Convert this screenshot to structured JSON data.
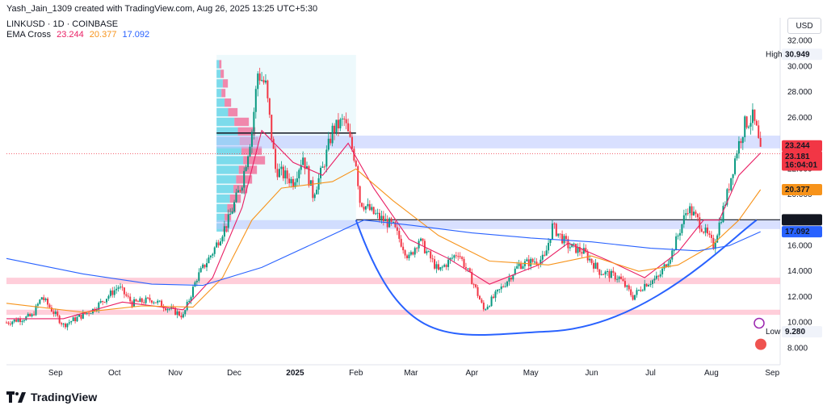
{
  "header": {
    "created_by": "Yash_Jain_1309 created with TradingView.com, Aug 26, 2025 13:25 UTC+5:30",
    "symbol_line": "LINKUSD · 1D · COINBASE",
    "indicator": "EMA Cross",
    "ema_values": [
      "23.244",
      "20.377",
      "17.092"
    ]
  },
  "currency": "USD",
  "brand": "TradingView",
  "colors": {
    "up": "#089981",
    "down": "#f23645",
    "ema_fast": "#e91e63",
    "ema_mid": "#f7931a",
    "ema_slow": "#2962ff",
    "zone_blue": "#b9c7ff",
    "zone_pink": "#ffb3c6",
    "arc": "#2962ff"
  },
  "chart_data": {
    "type": "candlestick",
    "title": "LINKUSD · 1D · COINBASE",
    "x_ticks": [
      "Sep",
      "Oct",
      "Nov",
      "Dec",
      "2025",
      "Feb",
      "Mar",
      "Apr",
      "May",
      "Jun",
      "Jul",
      "Aug",
      "Sep"
    ],
    "y_ticks": [
      "32.000",
      "30.000",
      "28.000",
      "26.000",
      "22.000",
      "20.000",
      "16.000",
      "14.000",
      "12.000",
      "10.000",
      "8.000"
    ],
    "ylim": [
      6.7,
      33.3
    ],
    "x_start": "2024-08-07",
    "x_end": "2025-09-05",
    "price_labels": [
      {
        "label": "High",
        "value": "30.949"
      },
      {
        "label": "",
        "value": "23.244"
      },
      {
        "label": "",
        "value": "23.181"
      },
      {
        "label": "",
        "value": "16:04:01"
      },
      {
        "label": "",
        "value": "20.377"
      },
      {
        "label": "",
        "value": "18.025"
      },
      {
        "label": "",
        "value": "17.092"
      },
      {
        "label": "Low",
        "value": "9.280"
      }
    ],
    "key_levels": {
      "resistance": 18.025,
      "last": 23.181,
      "high": 30.949,
      "low": 9.28
    },
    "zones": [
      {
        "kind": "blue",
        "from": 23.6,
        "to": 24.6,
        "start": "2024-11-22",
        "end": "2025-09-05"
      },
      {
        "kind": "blue",
        "from": 17.3,
        "to": 18.0,
        "start": "2024-11-22",
        "end": "2025-09-05"
      },
      {
        "kind": "pink",
        "from": 13.0,
        "to": 13.5,
        "start": "2024-08-07",
        "end": "2025-09-05"
      },
      {
        "kind": "pink",
        "from": 10.6,
        "to": 11.0,
        "start": "2024-08-07",
        "end": "2025-09-05"
      }
    ],
    "arc": {
      "start": "2025-02-01",
      "start_value": 18.0,
      "bottom": "2025-05-10",
      "bottom_value": 9.3,
      "end": "2025-08-24",
      "end_value": 18.0
    },
    "series": [
      {
        "name": "LINKUSD",
        "close": [
          [
            "2024-08-07",
            10.0
          ],
          [
            "2024-08-20",
            10.5
          ],
          [
            "2024-08-25",
            12.0
          ],
          [
            "2024-09-05",
            9.8
          ],
          [
            "2024-09-20",
            11.0
          ],
          [
            "2024-10-03",
            12.8
          ],
          [
            "2024-10-10",
            11.5
          ],
          [
            "2024-10-20",
            11.8
          ],
          [
            "2024-11-05",
            10.5
          ],
          [
            "2024-11-12",
            13.5
          ],
          [
            "2024-11-20",
            15.5
          ],
          [
            "2024-11-28",
            18.0
          ],
          [
            "2024-12-05",
            21.0
          ],
          [
            "2024-12-10",
            25.0
          ],
          [
            "2024-12-13",
            29.5
          ],
          [
            "2024-12-17",
            28.5
          ],
          [
            "2024-12-22",
            22.0
          ],
          [
            "2024-12-31",
            21.0
          ],
          [
            "2025-01-05",
            23.0
          ],
          [
            "2025-01-10",
            20.0
          ],
          [
            "2025-01-15",
            22.0
          ],
          [
            "2025-01-20",
            25.0
          ],
          [
            "2025-01-26",
            25.8
          ],
          [
            "2025-02-01",
            22.5
          ],
          [
            "2025-02-03",
            19.5
          ],
          [
            "2025-02-10",
            18.5
          ],
          [
            "2025-02-20",
            17.5
          ],
          [
            "2025-02-28",
            15.0
          ],
          [
            "2025-03-05",
            16.5
          ],
          [
            "2025-03-15",
            14.0
          ],
          [
            "2025-03-25",
            15.5
          ],
          [
            "2025-04-02",
            13.0
          ],
          [
            "2025-04-07",
            11.0
          ],
          [
            "2025-04-15",
            12.5
          ],
          [
            "2025-04-25",
            14.5
          ],
          [
            "2025-05-08",
            15.0
          ],
          [
            "2025-05-12",
            17.5
          ],
          [
            "2025-05-20",
            16.0
          ],
          [
            "2025-05-28",
            15.5
          ],
          [
            "2025-06-05",
            14.0
          ],
          [
            "2025-06-15",
            13.5
          ],
          [
            "2025-06-22",
            12.0
          ],
          [
            "2025-06-28",
            13.0
          ],
          [
            "2025-07-05",
            13.5
          ],
          [
            "2025-07-12",
            15.5
          ],
          [
            "2025-07-20",
            19.0
          ],
          [
            "2025-07-25",
            18.0
          ],
          [
            "2025-08-02",
            16.0
          ],
          [
            "2025-08-09",
            20.0
          ],
          [
            "2025-08-14",
            23.5
          ],
          [
            "2025-08-18",
            25.5
          ],
          [
            "2025-08-22",
            26.0
          ],
          [
            "2025-08-24",
            25.0
          ],
          [
            "2025-08-26",
            23.181
          ]
        ]
      },
      {
        "name": "EMA fast",
        "values": [
          [
            "2024-08-07",
            10.3
          ],
          [
            "2024-09-05",
            10.3
          ],
          [
            "2024-10-05",
            11.6
          ],
          [
            "2024-11-05",
            11.0
          ],
          [
            "2024-11-20",
            13.5
          ],
          [
            "2024-12-05",
            19.0
          ],
          [
            "2024-12-15",
            25.0
          ],
          [
            "2024-12-31",
            22.5
          ],
          [
            "2025-01-15",
            21.5
          ],
          [
            "2025-01-28",
            24.0
          ],
          [
            "2025-02-10",
            20.5
          ],
          [
            "2025-02-28",
            16.5
          ],
          [
            "2025-03-20",
            15.0
          ],
          [
            "2025-04-10",
            13.0
          ],
          [
            "2025-05-05",
            14.5
          ],
          [
            "2025-05-20",
            16.2
          ],
          [
            "2025-06-10",
            14.8
          ],
          [
            "2025-06-28",
            13.5
          ],
          [
            "2025-07-15",
            15.5
          ],
          [
            "2025-07-28",
            18.0
          ],
          [
            "2025-08-05",
            18.0
          ],
          [
            "2025-08-15",
            21.5
          ],
          [
            "2025-08-26",
            23.244
          ]
        ]
      },
      {
        "name": "EMA mid",
        "values": [
          [
            "2024-08-07",
            11.5
          ],
          [
            "2024-09-15",
            10.8
          ],
          [
            "2024-10-15",
            11.3
          ],
          [
            "2024-11-10",
            11.2
          ],
          [
            "2024-11-25",
            13.5
          ],
          [
            "2024-12-10",
            18.0
          ],
          [
            "2024-12-25",
            20.5
          ],
          [
            "2025-01-20",
            21.0
          ],
          [
            "2025-02-01",
            22.0
          ],
          [
            "2025-02-20",
            19.5
          ],
          [
            "2025-03-15",
            16.8
          ],
          [
            "2025-04-10",
            14.8
          ],
          [
            "2025-05-10",
            14.5
          ],
          [
            "2025-06-01",
            15.2
          ],
          [
            "2025-06-25",
            14.0
          ],
          [
            "2025-07-15",
            14.5
          ],
          [
            "2025-08-01",
            16.0
          ],
          [
            "2025-08-15",
            18.0
          ],
          [
            "2025-08-26",
            20.377
          ]
        ]
      },
      {
        "name": "EMA slow",
        "values": [
          [
            "2024-08-07",
            15.0
          ],
          [
            "2024-09-15",
            13.8
          ],
          [
            "2024-10-20",
            13.0
          ],
          [
            "2024-11-15",
            12.9
          ],
          [
            "2024-12-15",
            14.3
          ],
          [
            "2025-01-15",
            16.5
          ],
          [
            "2025-02-05",
            18.0
          ],
          [
            "2025-03-01",
            17.6
          ],
          [
            "2025-04-01",
            17.0
          ],
          [
            "2025-05-01",
            16.6
          ],
          [
            "2025-06-01",
            16.3
          ],
          [
            "2025-07-01",
            15.8
          ],
          [
            "2025-07-25",
            15.6
          ],
          [
            "2025-08-10",
            16.0
          ],
          [
            "2025-08-26",
            17.092
          ]
        ]
      }
    ]
  }
}
